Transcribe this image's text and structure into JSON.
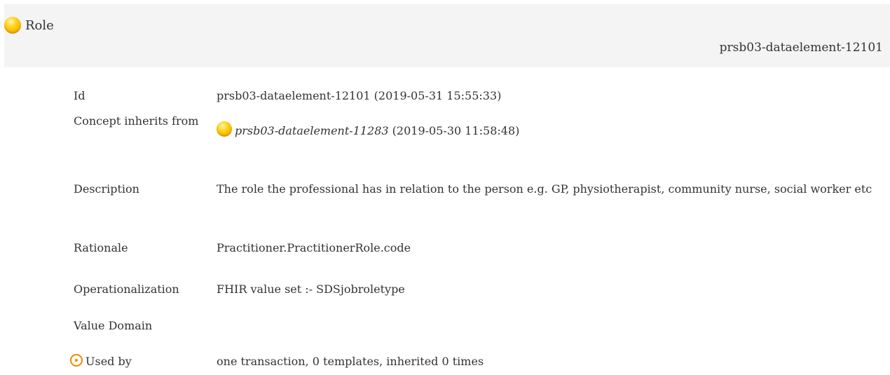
{
  "header": {
    "title": "Role",
    "concept_id": "prsb03-dataelement-12101",
    "icon": "concept-orb-icon"
  },
  "rows": [
    {
      "label": "Id",
      "value": "prsb03-dataelement-12101 (2019-05-31 15:55:33)"
    },
    {
      "label": "Concept inherits from",
      "value_link": "prsb03-dataelement-11283",
      "value_suffix": " (2019-05-30 11:58:48)",
      "icon": "concept-orb-icon"
    },
    {
      "label": "Description",
      "value": "The role the professional has in relation to the person e.g. GP, physiotherapist, community nurse, social worker etc"
    },
    {
      "label": "Rationale",
      "value": "Practitioner.PractitionerRole.code"
    },
    {
      "label": "Operationalization",
      "value": "FHIR value set :- SDSjobroletype"
    },
    {
      "label": "Value Domain",
      "value": ""
    },
    {
      "label": "Used by",
      "value": "one transaction, 0 templates, inherited 0 times",
      "icon": "target-icon"
    }
  ],
  "colors": {
    "header_bg": "#f4f4f4",
    "orb": "#f4b400",
    "target": "#f08a00"
  }
}
